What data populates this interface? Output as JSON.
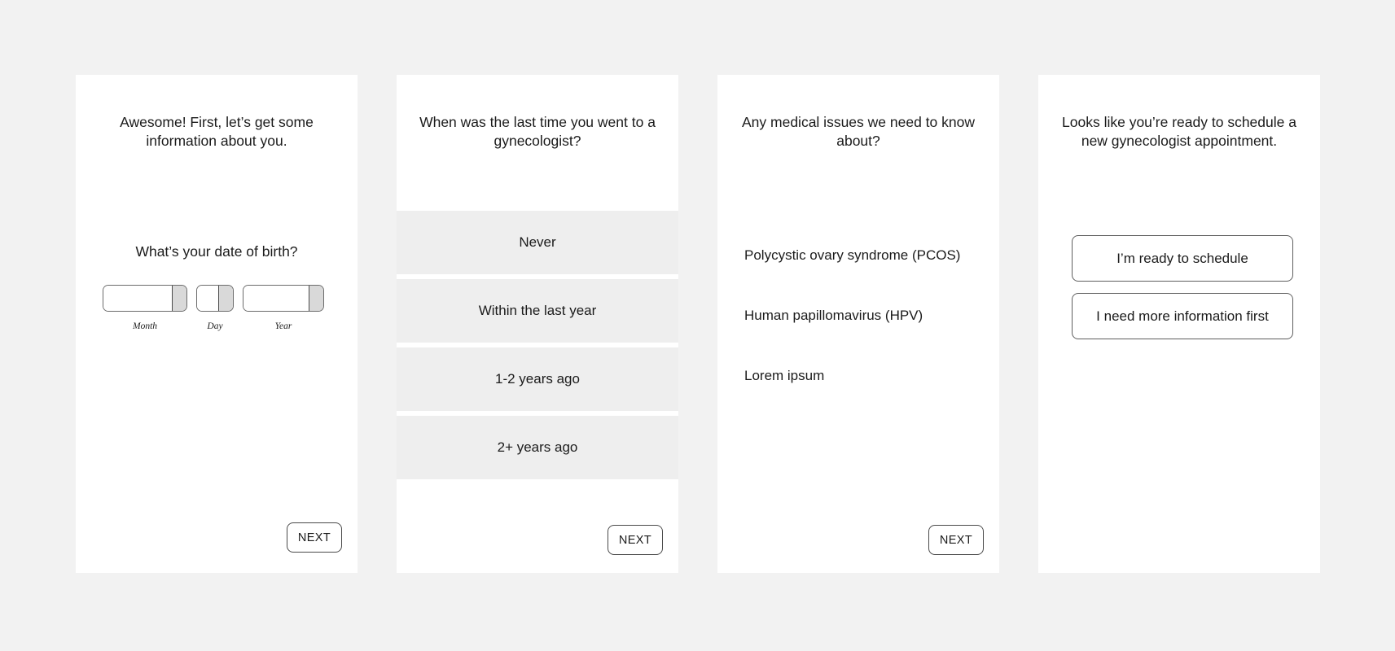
{
  "background_color": "#f2f2f2",
  "panel_color": "#ffffff",
  "option_band_color": "#eeeeee",
  "panels": [
    {
      "id": "date-of-birth",
      "prompt": "Awesome! First, let’s get some information about you.",
      "sub_prompt": "What’s your date of birth?",
      "date_fields": [
        {
          "label": "Month",
          "value": ""
        },
        {
          "label": "Day",
          "value": ""
        },
        {
          "label": "Year",
          "value": ""
        }
      ],
      "next_label": "NEXT"
    },
    {
      "id": "last-gynecologist-visit",
      "prompt": "When was the last time you went to a gynecologist?",
      "options": [
        "Never",
        "Within the last year",
        "1-2 years ago",
        "2+ years ago"
      ],
      "next_label": "NEXT"
    },
    {
      "id": "medical-issues",
      "prompt": "Any medical issues we need to know about?",
      "issues": [
        "Polycystic ovary syndrome (PCOS)",
        "Human papillomavirus  (HPV)",
        "Lorem ipsum"
      ],
      "next_label": "NEXT"
    },
    {
      "id": "schedule-readiness",
      "prompt": "Looks like you’re ready to schedule a new gynecologist appointment.",
      "choices": [
        "I’m ready to schedule",
        "I need more information first"
      ]
    }
  ]
}
